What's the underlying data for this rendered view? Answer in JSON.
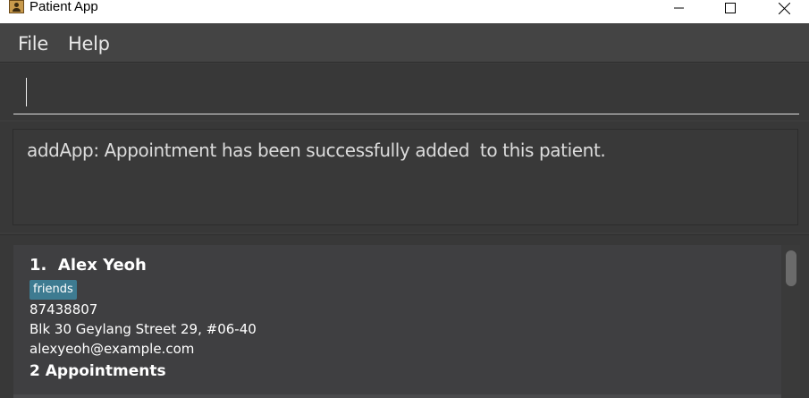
{
  "window": {
    "title": "Patient App",
    "icon": "user-contact-icon"
  },
  "menu": {
    "items": [
      {
        "label": "File"
      },
      {
        "label": "Help"
      }
    ]
  },
  "command": {
    "value": "",
    "placeholder": ""
  },
  "result": {
    "message": "addApp: Appointment has been successfully added  to this patient."
  },
  "patients": [
    {
      "index_name": "1.  Alex Yeoh",
      "tags": [
        "friends"
      ],
      "phone": "87438807",
      "address": "Blk 30 Geylang Street 29, #06-40",
      "email": "alexyeoh@example.com",
      "appointments": "2 Appointments"
    }
  ],
  "colors": {
    "background": "#3c3c3c",
    "tag": "#3e7b91",
    "card": "#3f3f41"
  }
}
